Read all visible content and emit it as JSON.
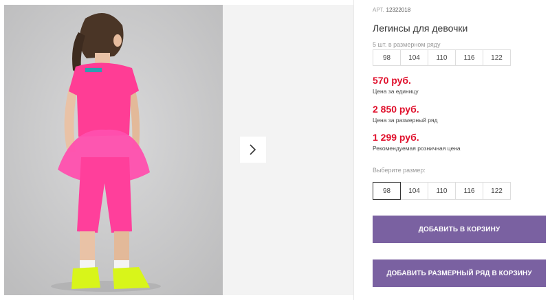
{
  "product": {
    "art_label": "АРТ.",
    "art_number": "12322018",
    "title": "Легинсы для девочки",
    "row_note": "5 шт. в размерном ряду",
    "row_sizes": [
      "98",
      "104",
      "110",
      "116",
      "122"
    ],
    "price_unit": "570 руб.",
    "price_unit_label": "Цена за единицу",
    "price_row": "2 850 руб.",
    "price_row_label": "Цена за размерный ряд",
    "price_retail": "1 299 руб.",
    "price_retail_label": "Рекомендуемая розничная цена",
    "choose_size_label": "Выберите размер:",
    "select_sizes": [
      "98",
      "104",
      "110",
      "116",
      "122"
    ],
    "selected_size": "98",
    "add_to_cart": "ДОБАВИТЬ В КОРЗИНУ",
    "add_row_to_cart": "ДОБАВИТЬ РАЗМЕРНЫЙ РЯД В КОРЗИНУ"
  },
  "gallery": {
    "next_icon": "chevron-right-icon"
  },
  "colors": {
    "price": "#e0102c",
    "button": "#7a61a1",
    "outfit": "#ff3aa0",
    "shoes": "#d8f51a"
  }
}
